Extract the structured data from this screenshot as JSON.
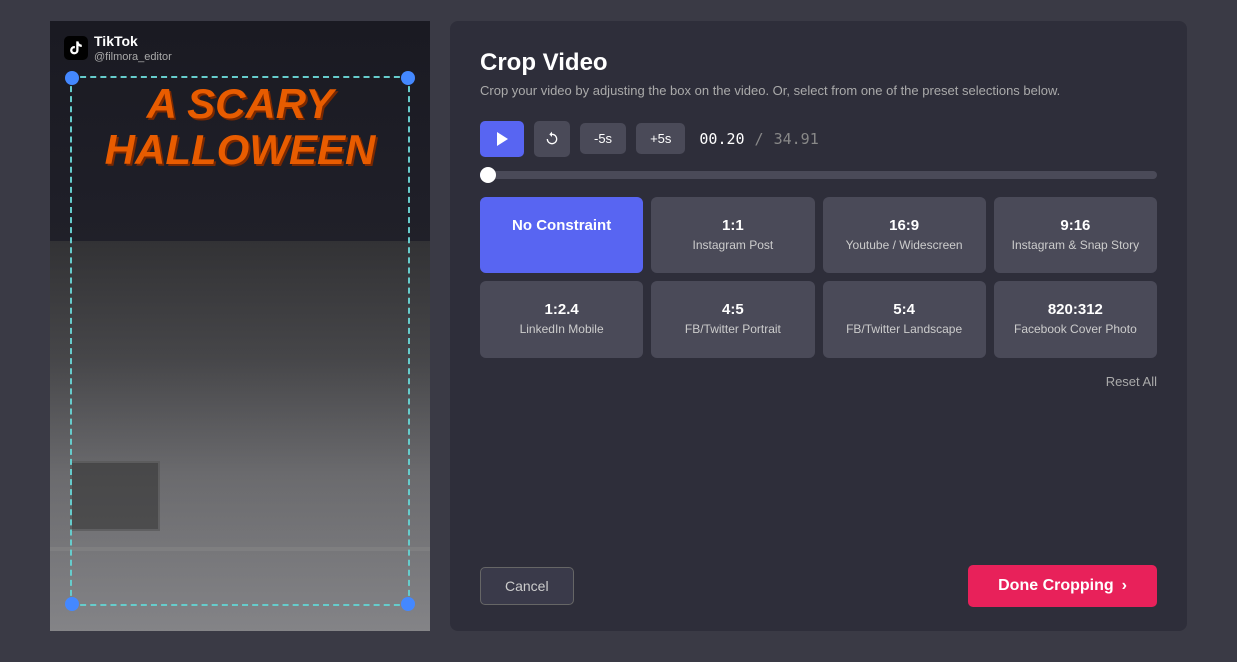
{
  "app": {
    "tiktok_name": "TikTok",
    "tiktok_handle": "@filmora_editor"
  },
  "panel": {
    "title": "Crop Video",
    "subtitle": "Crop your video by adjusting the box on the video. Or, select from one of the preset selections below."
  },
  "controls": {
    "minus5_label": "-5s",
    "plus5_label": "+5s",
    "current_time": "00.20",
    "total_time": "34.91",
    "time_separator": "/"
  },
  "presets": [
    {
      "id": "no-constraint",
      "ratio": "No Constraint",
      "name": "",
      "active": true
    },
    {
      "id": "1-1",
      "ratio": "1:1",
      "name": "Instagram Post",
      "active": false
    },
    {
      "id": "16-9",
      "ratio": "16:9",
      "name": "Youtube / Widescreen",
      "active": false
    },
    {
      "id": "9-16",
      "ratio": "9:16",
      "name": "Instagram & Snap Story",
      "active": false
    },
    {
      "id": "1-2-4",
      "ratio": "1:2.4",
      "name": "LinkedIn Mobile",
      "active": false
    },
    {
      "id": "4-5",
      "ratio": "4:5",
      "name": "FB/Twitter Portrait",
      "active": false
    },
    {
      "id": "5-4",
      "ratio": "5:4",
      "name": "FB/Twitter Landscape",
      "active": false
    },
    {
      "id": "820-312",
      "ratio": "820:312",
      "name": "Facebook Cover Photo",
      "active": false
    }
  ],
  "actions": {
    "reset_label": "Reset All",
    "cancel_label": "Cancel",
    "done_label": "Done Cropping"
  },
  "halloween_text": {
    "line1": "A SCARY",
    "line2": "HALLOWEEN"
  }
}
